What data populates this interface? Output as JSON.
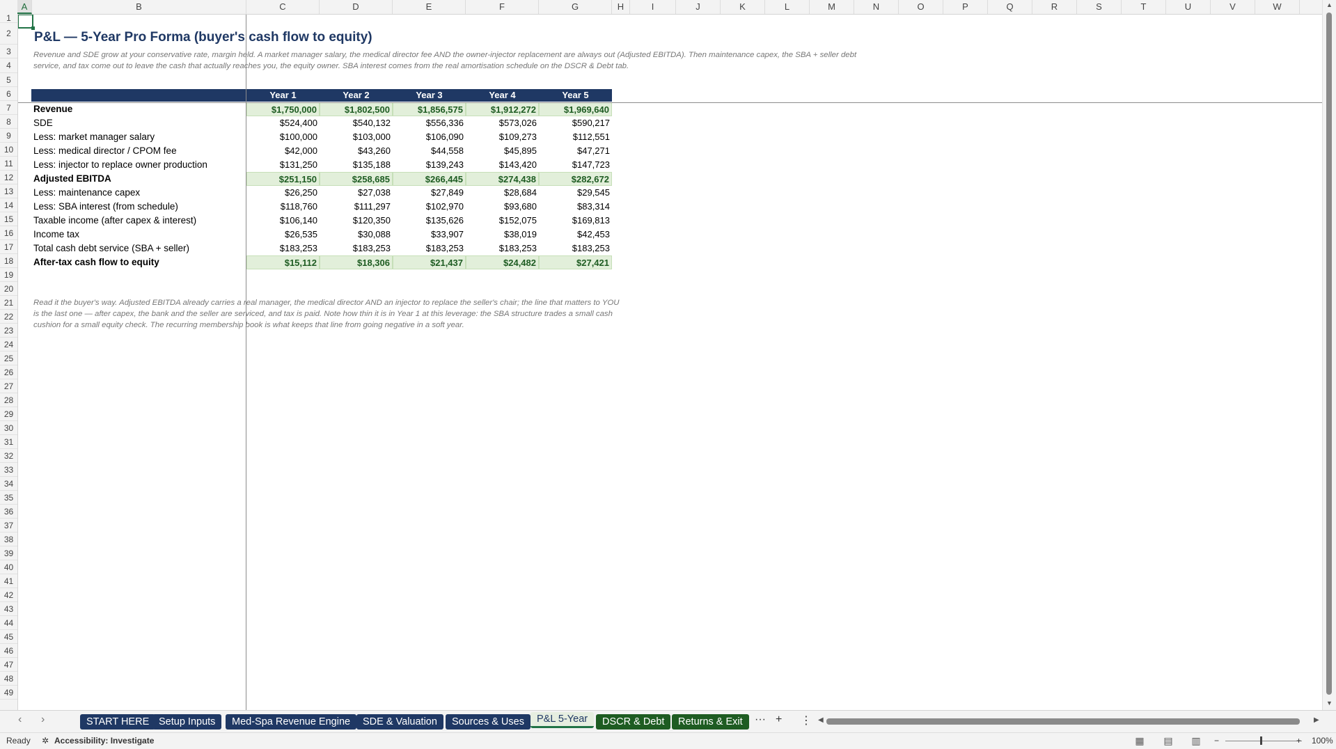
{
  "columns": [
    "A",
    "B",
    "C",
    "D",
    "E",
    "F",
    "G",
    "H",
    "I",
    "J",
    "K",
    "L",
    "M",
    "N",
    "O",
    "P",
    "Q",
    "R",
    "S",
    "T",
    "U",
    "V",
    "W"
  ],
  "rows": [
    "1",
    "2",
    "3",
    "4",
    "5",
    "6",
    "7",
    "8",
    "9",
    "10",
    "11",
    "12",
    "13",
    "14",
    "15",
    "16",
    "17",
    "18",
    "19",
    "20",
    "21",
    "22",
    "23",
    "24",
    "25",
    "26",
    "27",
    "28",
    "29",
    "30",
    "31",
    "32",
    "33",
    "34",
    "35",
    "36",
    "37",
    "38",
    "39",
    "40",
    "41",
    "42",
    "43",
    "44",
    "45",
    "46",
    "47",
    "48",
    "49"
  ],
  "sheet": {
    "title": "P&L — 5-Year Pro Forma (buyer's cash flow to equity)",
    "subtitle_line1": "Revenue and SDE grow at your conservative rate, margin held. A market manager salary, the medical director fee AND the owner-injector replacement are always out (Adjusted EBITDA). Then maintenance capex, the SBA + seller debt",
    "subtitle_line2": "service, and tax come out to leave the cash that actually reaches you, the equity owner. SBA interest comes from the real amortisation schedule on the DSCR & Debt tab.",
    "headers": [
      "Year 1",
      "Year 2",
      "Year 3",
      "Year 4",
      "Year 5"
    ],
    "table": [
      {
        "label": "Revenue",
        "values": [
          "$1,750,000",
          "$1,802,500",
          "$1,856,575",
          "$1,912,272",
          "$1,969,640"
        ]
      },
      {
        "label": "SDE",
        "values": [
          "$524,400",
          "$540,132",
          "$556,336",
          "$573,026",
          "$590,217"
        ]
      },
      {
        "label": "Less: market manager salary",
        "values": [
          "$100,000",
          "$103,000",
          "$106,090",
          "$109,273",
          "$112,551"
        ]
      },
      {
        "label": "Less: medical director / CPOM fee",
        "values": [
          "$42,000",
          "$43,260",
          "$44,558",
          "$45,895",
          "$47,271"
        ]
      },
      {
        "label": "Less: injector to replace owner production",
        "values": [
          "$131,250",
          "$135,188",
          "$139,243",
          "$143,420",
          "$147,723"
        ]
      },
      {
        "label": "Adjusted EBITDA",
        "values": [
          "$251,150",
          "$258,685",
          "$266,445",
          "$274,438",
          "$282,672"
        ]
      },
      {
        "label": "Less: maintenance capex",
        "values": [
          "$26,250",
          "$27,038",
          "$27,849",
          "$28,684",
          "$29,545"
        ]
      },
      {
        "label": "Less: SBA interest (from schedule)",
        "values": [
          "$118,760",
          "$111,297",
          "$102,970",
          "$93,680",
          "$83,314"
        ]
      },
      {
        "label": "Taxable income (after capex & interest)",
        "values": [
          "$106,140",
          "$120,350",
          "$135,626",
          "$152,075",
          "$169,813"
        ]
      },
      {
        "label": "Income tax",
        "values": [
          "$26,535",
          "$30,088",
          "$33,907",
          "$38,019",
          "$42,453"
        ]
      },
      {
        "label": "Total cash debt service (SBA + seller)",
        "values": [
          "$183,253",
          "$183,253",
          "$183,253",
          "$183,253",
          "$183,253"
        ]
      },
      {
        "label": "After-tax cash flow to equity",
        "values": [
          "$15,112",
          "$18,306",
          "$21,437",
          "$24,482",
          "$27,421"
        ]
      }
    ],
    "note_line1": "Read it the buyer's way. Adjusted EBITDA already carries a real manager, the medical director AND an injector to replace the seller's chair; the line that matters to YOU",
    "note_line2": "is the last one — after capex, the bank and the seller are serviced, and tax is paid. Note how thin it is in Year 1 at this leverage: the SBA structure trades a small cash",
    "note_line3": "cushion for a small equity check. The recurring membership book is what keeps that line from going negative in a soft year."
  },
  "tabs": [
    {
      "label": "START HERE"
    },
    {
      "label": "Setup Inputs"
    },
    {
      "label": "Med-Spa Revenue Engine"
    },
    {
      "label": "SDE & Valuation"
    },
    {
      "label": "Sources & Uses"
    },
    {
      "label": "P&L 5-Year"
    },
    {
      "label": "DSCR & Debt"
    },
    {
      "label": "Returns & Exit"
    }
  ],
  "tabtools": {
    "more": "···",
    "add": "+",
    "options": "⋮"
  },
  "status": {
    "ready": "Ready",
    "accessibility": "Accessibility: Investigate",
    "zoom": "100%"
  },
  "colors": {
    "navy": "#1f3864",
    "green": "#1e5c22",
    "highlight": "#e2efda"
  }
}
